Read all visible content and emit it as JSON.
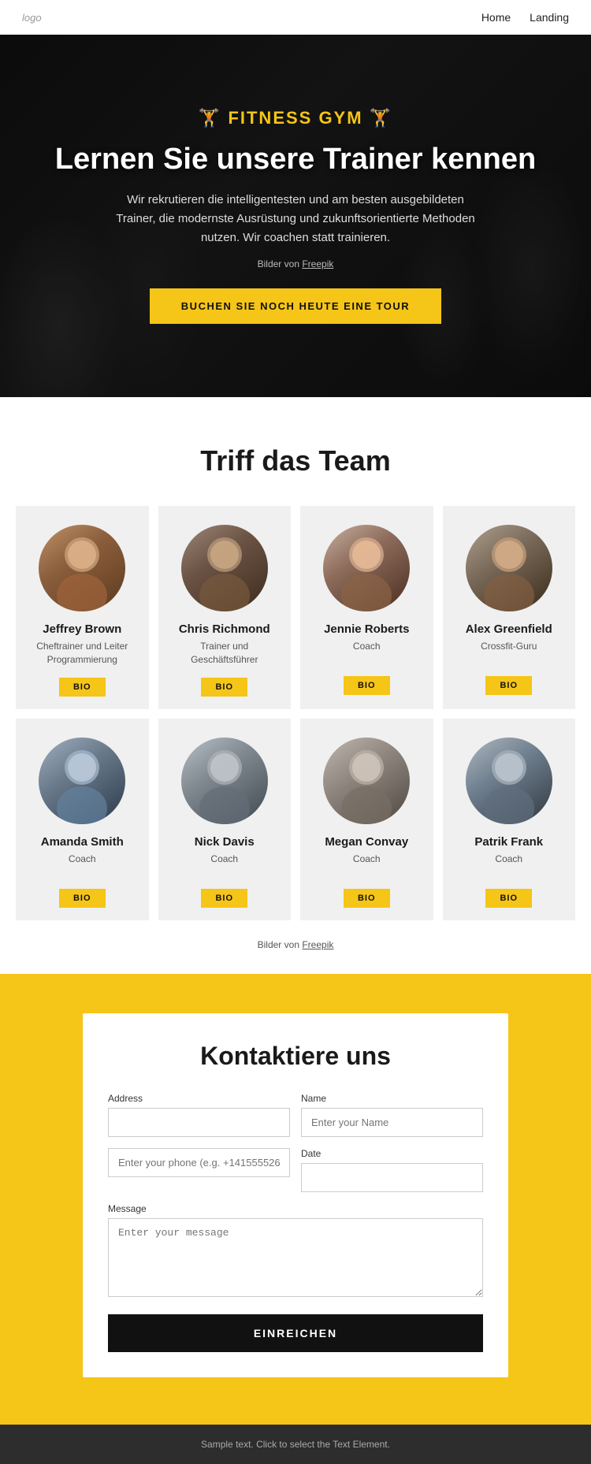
{
  "nav": {
    "logo": "logo",
    "links": [
      {
        "label": "Home",
        "href": "#"
      },
      {
        "label": "Landing",
        "href": "#"
      }
    ]
  },
  "hero": {
    "brand": "FITNESS GYM",
    "title": "Lernen Sie unsere Trainer kennen",
    "description": "Wir rekrutieren die intelligentesten und am besten ausgebildeten Trainer, die modernste Ausrüstung und zukunftsorientierte Methoden nutzen. Wir coachen statt trainieren.",
    "credit_prefix": "Bilder von",
    "credit_link": "Freepik",
    "cta_button": "BUCHEN SIE NOCH HEUTE EINE TOUR"
  },
  "team": {
    "section_title": "Triff das Team",
    "members": [
      {
        "id": 1,
        "name": "Jeffrey Brown",
        "role": "Cheftrainer und Leiter Programmierung",
        "bio_btn": "BIO",
        "avatar_class": "avatar-1"
      },
      {
        "id": 2,
        "name": "Chris Richmond",
        "role": "Trainer und Geschäftsführer",
        "bio_btn": "BIO",
        "avatar_class": "avatar-2"
      },
      {
        "id": 3,
        "name": "Jennie Roberts",
        "role": "Coach",
        "bio_btn": "BIO",
        "avatar_class": "avatar-3"
      },
      {
        "id": 4,
        "name": "Alex Greenfield",
        "role": "Crossfit-Guru",
        "bio_btn": "BIO",
        "avatar_class": "avatar-4"
      },
      {
        "id": 5,
        "name": "Amanda Smith",
        "role": "Coach",
        "bio_btn": "BIO",
        "avatar_class": "avatar-5"
      },
      {
        "id": 6,
        "name": "Nick Davis",
        "role": "Coach",
        "bio_btn": "BIO",
        "avatar_class": "avatar-6"
      },
      {
        "id": 7,
        "name": "Megan Convay",
        "role": "Coach",
        "bio_btn": "BIO",
        "avatar_class": "avatar-7"
      },
      {
        "id": 8,
        "name": "Patrik Frank",
        "role": "Coach",
        "bio_btn": "BIO",
        "avatar_class": "avatar-8"
      }
    ],
    "credit_prefix": "Bilder von",
    "credit_link": "Freepik"
  },
  "contact": {
    "title": "Kontaktiere uns",
    "fields": {
      "address_label": "Address",
      "name_label": "Name",
      "name_placeholder": "Enter your Name",
      "phone_placeholder": "Enter your phone (e.g. +141555526)",
      "date_label": "Date",
      "date_placeholder": "",
      "message_label": "Message",
      "message_placeholder": "Enter your message"
    },
    "submit_btn": "EINREICHEN"
  },
  "footer": {
    "text": "Sample text. Click to select the Text Element."
  }
}
